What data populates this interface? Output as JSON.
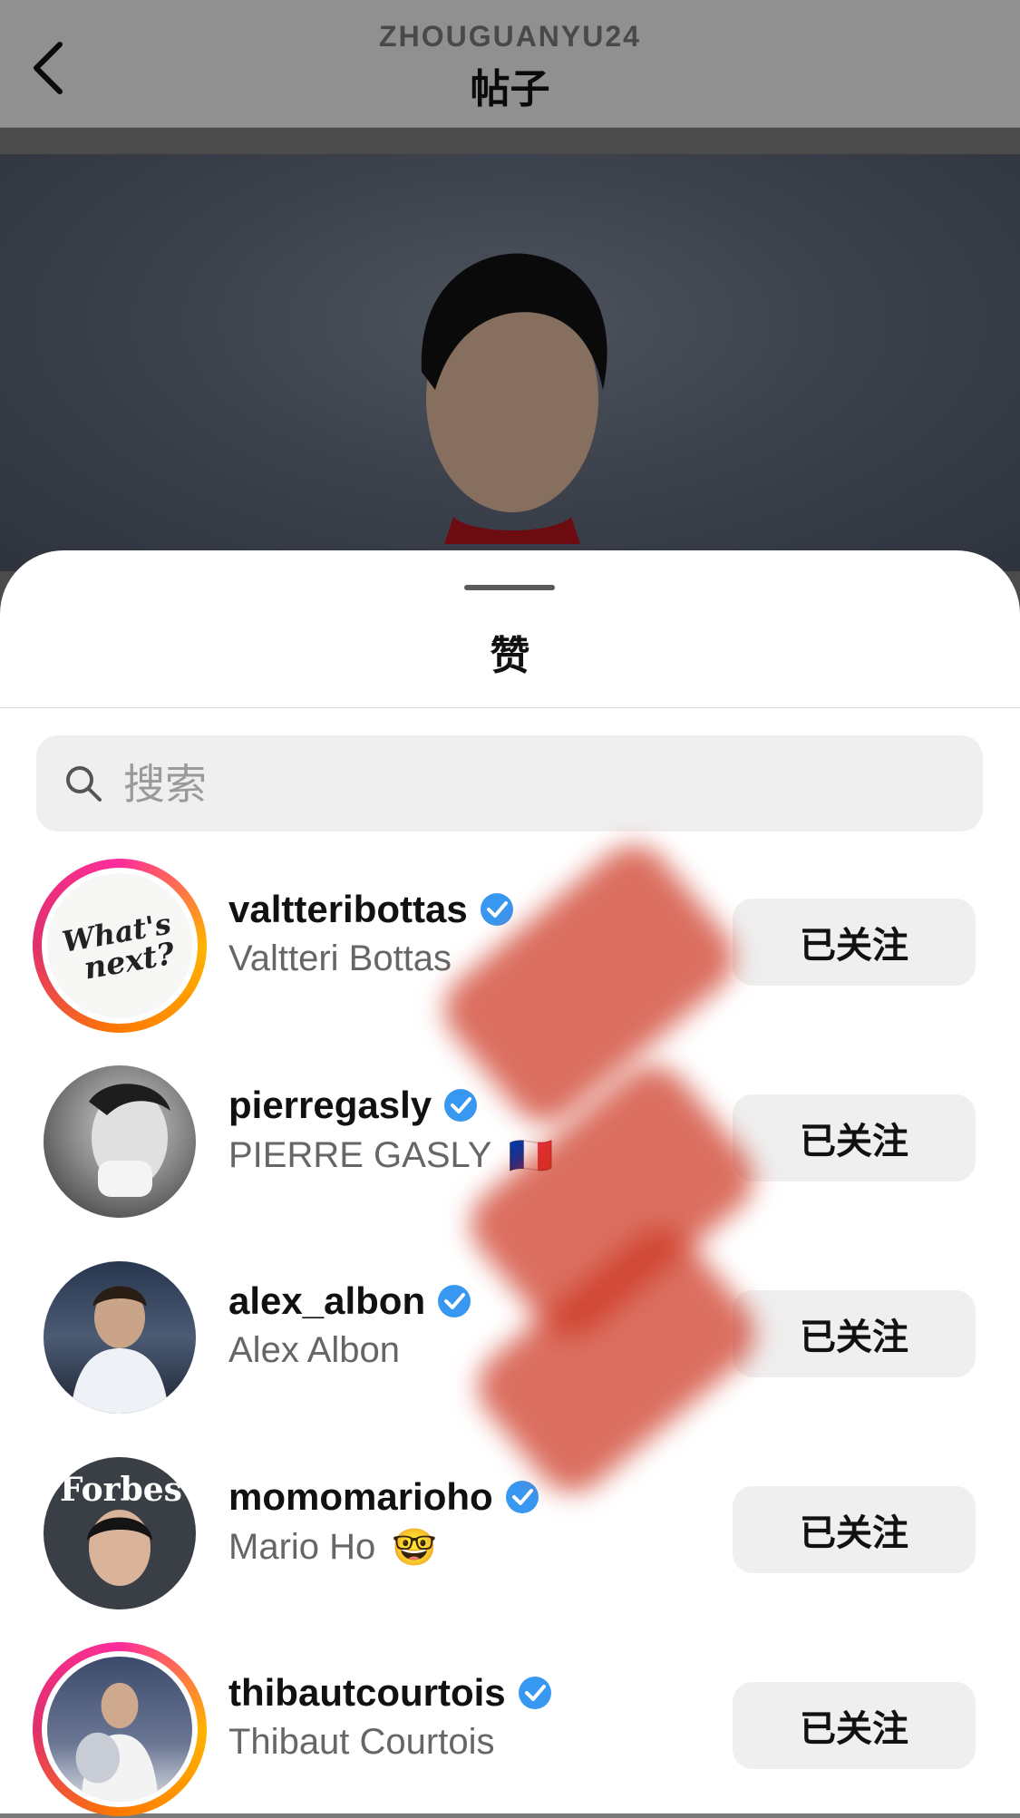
{
  "header": {
    "username": "ZHOUGUANYU24",
    "title": "帖子"
  },
  "sheet": {
    "title": "赞",
    "search_placeholder": "搜索"
  },
  "likers": [
    {
      "username": "valtteribottas",
      "full_name": "Valtteri Bottas",
      "verified": true,
      "button": "已关注",
      "story_ring": true,
      "emoji": ""
    },
    {
      "username": "pierregasly",
      "full_name": "PIERRE GASLY",
      "verified": true,
      "button": "已关注",
      "story_ring": false,
      "emoji": "🇫🇷"
    },
    {
      "username": "alex_albon",
      "full_name": "Alex Albon",
      "verified": true,
      "button": "已关注",
      "story_ring": false,
      "emoji": ""
    },
    {
      "username": "momomarioho",
      "full_name": "Mario Ho",
      "verified": true,
      "button": "已关注",
      "story_ring": false,
      "emoji": "🤓"
    },
    {
      "username": "thibautcourtois",
      "full_name": "Thibaut Courtois",
      "verified": true,
      "button": "已关注",
      "story_ring": true,
      "emoji": ""
    }
  ],
  "avatar_text": {
    "valtteribottas": "What's next?",
    "momomarioho": "Forbes"
  },
  "colors": {
    "verified_badge": "#3897f0",
    "redaction": "#cd3723"
  }
}
